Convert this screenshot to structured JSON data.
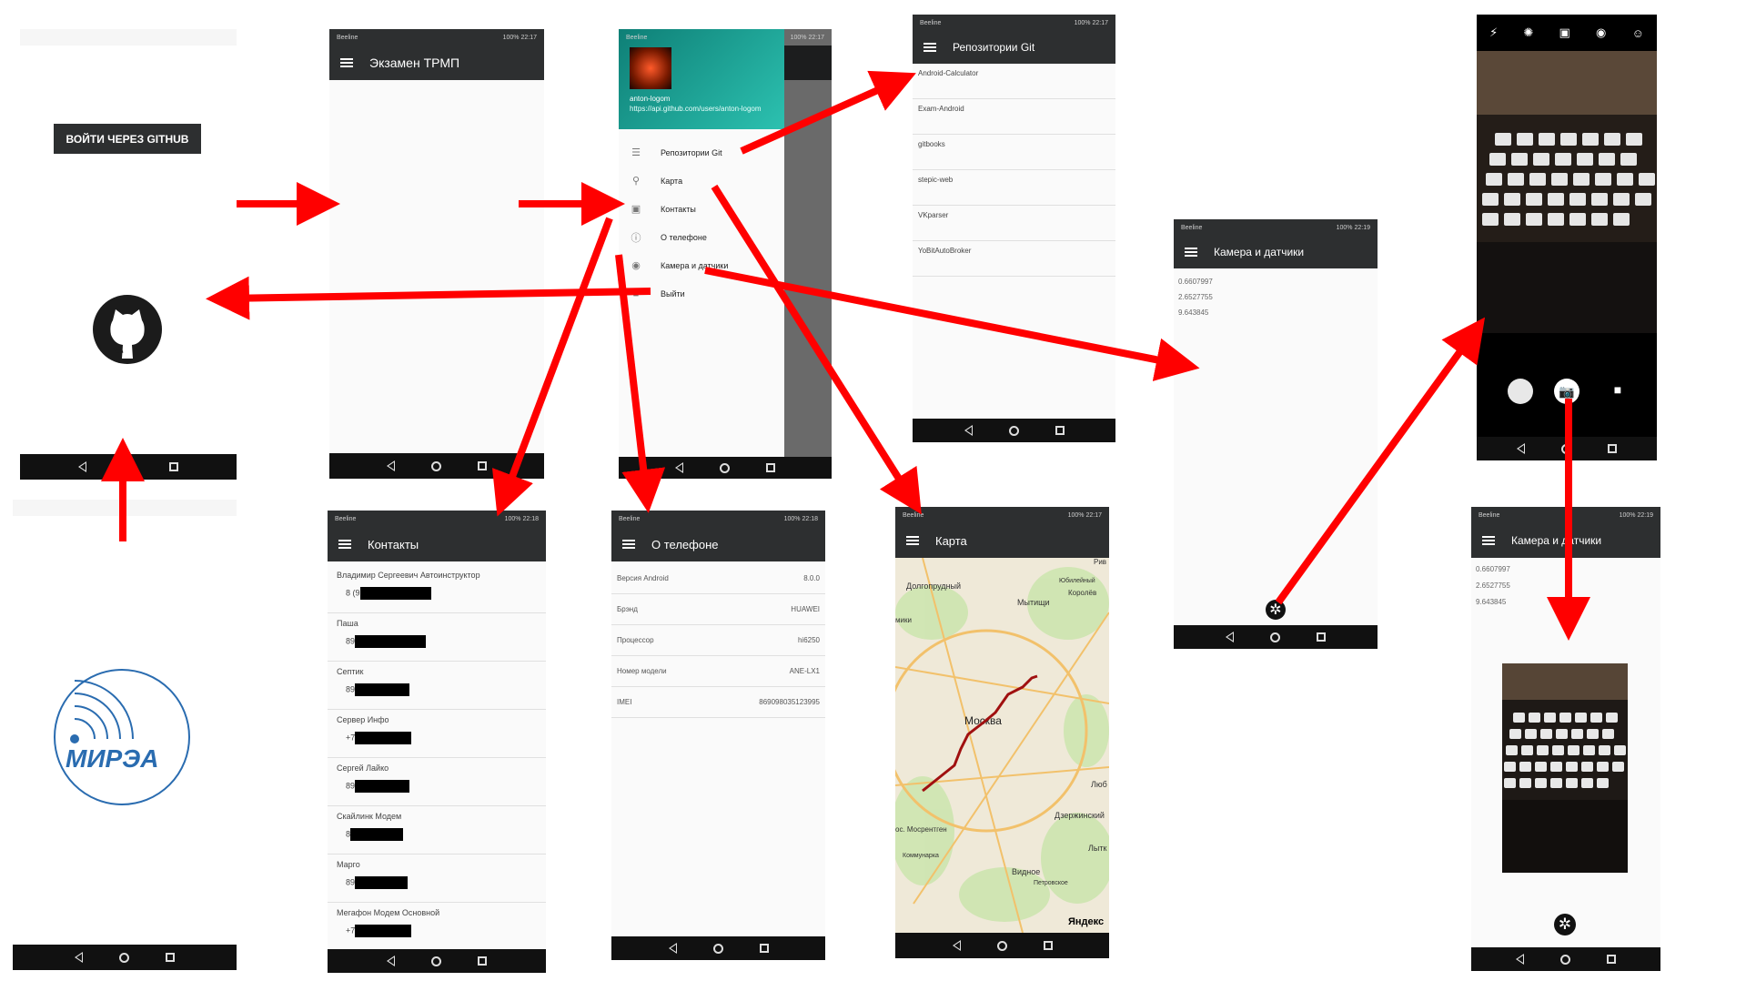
{
  "login_screen": {
    "button_label": "ВОЙТИ ЧЕРЕЗ GITHUB",
    "logo_text": "МИРЭА"
  },
  "main_screen": {
    "status_time": "22:17",
    "status_battery": "100%",
    "title": "Экзамен ТРМП"
  },
  "drawer": {
    "status_time": "22:17",
    "status_battery": "100%",
    "username": "anton-logom",
    "url": "https://api.github.com/users/anton-logom",
    "items": [
      {
        "label": "Репозитории Git",
        "icon": "list-icon"
      },
      {
        "label": "Карта",
        "icon": "map-pin-icon"
      },
      {
        "label": "Контакты",
        "icon": "contacts-icon"
      },
      {
        "label": "О телефоне",
        "icon": "info-icon"
      },
      {
        "label": "Камера и датчики",
        "icon": "camera-bulb-icon"
      },
      {
        "label": "Выйти",
        "icon": "exit-icon"
      }
    ]
  },
  "repos_screen": {
    "status_time": "22:17",
    "status_battery": "100%",
    "title": "Репозитории Git",
    "repos": [
      "Android-Calculator",
      "Exam-Android",
      "gitbooks",
      "stepic-web",
      "VKparser",
      "YoBitAutoBroker"
    ]
  },
  "contacts_screen": {
    "status_time": "22:18",
    "status_battery": "100%",
    "title": "Контакты",
    "contacts": [
      {
        "name": "Владимир Сергеевич Автоинструктор",
        "phone_prefix": "8 (9"
      },
      {
        "name": "Паша",
        "phone_prefix": "89"
      },
      {
        "name": "Септик",
        "phone_prefix": "89"
      },
      {
        "name": "Сервер Инфо",
        "phone_prefix": "+7"
      },
      {
        "name": "Сергей Лайко",
        "phone_prefix": "89"
      },
      {
        "name": "Скайлинк Модем",
        "phone_prefix": "8"
      },
      {
        "name": "Марго",
        "phone_prefix": "89"
      },
      {
        "name": "Мегафон Модем Основной",
        "phone_prefix": "+7"
      }
    ]
  },
  "phone_info_screen": {
    "status_time": "22:18",
    "status_battery": "100%",
    "title": "О телефоне",
    "rows": [
      {
        "label": "Версия Android",
        "value": "8.0.0"
      },
      {
        "label": "Брэнд",
        "value": "HUAWEI"
      },
      {
        "label": "Процессор",
        "value": "hi6250"
      },
      {
        "label": "Номер модели",
        "value": "ANE-LX1"
      },
      {
        "label": "IMEI",
        "value": "869098035123995"
      }
    ]
  },
  "map_screen": {
    "status_time": "22:17",
    "status_battery": "100%",
    "title": "Карта",
    "labels": [
      "Долгопрудный",
      "Мытищи",
      "Королёв",
      "Юбилейный",
      "Москва",
      "Дзержинский",
      "Видное",
      "Петровское",
      "Коммунарка",
      "Лытк",
      "Люб",
      "мики",
      "Рив",
      "ос. Мосрентген"
    ],
    "brand": "Яндекс",
    "route_color": "#a01010"
  },
  "sensors_screen": {
    "status_time": "22:19",
    "status_battery": "100%",
    "title": "Камера и датчики",
    "values": [
      "0.6607997",
      "2.6527755",
      "9.643845"
    ]
  },
  "sensors_photo_screen": {
    "status_time": "22:19",
    "status_battery": "100%",
    "title": "Камера и датчики",
    "values": [
      "0.6607997",
      "2.6527755",
      "9.643845"
    ]
  },
  "colors": {
    "arrow": "#ff0000",
    "appbar": "#2d2f30",
    "drawer_header": "#1ba89a"
  }
}
